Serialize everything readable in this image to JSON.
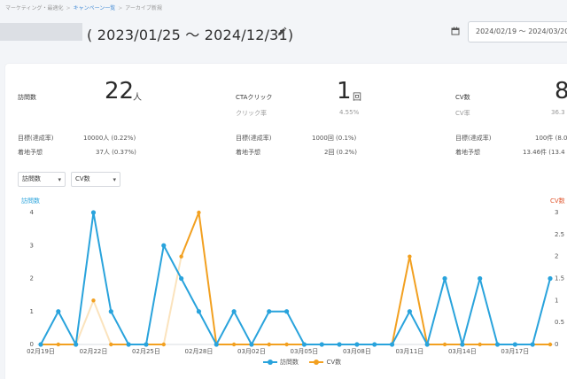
{
  "breadcrumb": [
    {
      "label": "マーケティング・最適化",
      "link": false
    },
    {
      "label": "キャンペーン一覧",
      "link": true
    },
    {
      "label": "アーカイブ新規",
      "link": false
    }
  ],
  "header": {
    "date_range": "( 2023/01/25 ～ 2024/12/31)",
    "picker_value": "2024/02/19 ～ 2024/03/20"
  },
  "metrics": [
    {
      "label": "訪問数",
      "value": "22",
      "unit": "人",
      "sub_label": "",
      "sub_value": "",
      "rows": [
        {
          "label": "目標(達成率)",
          "value": "10000人 (0.22%)"
        },
        {
          "label": "着地予想",
          "value": "37人 (0.37%)"
        }
      ]
    },
    {
      "label": "CTAクリック",
      "value": "1",
      "unit": "回",
      "sub_label": "クリック率",
      "sub_value": "4.55%",
      "rows": [
        {
          "label": "目標(達成率)",
          "value": "1000回 (0.1%)"
        },
        {
          "label": "着地予想",
          "value": "2回 (0.2%)"
        }
      ]
    },
    {
      "label": "CV数",
      "value": "8",
      "unit": "",
      "sub_label": "CV率",
      "sub_value": "36.3",
      "rows": [
        {
          "label": "目標(達成率)",
          "value": "100件 (8.0"
        },
        {
          "label": "着地予想",
          "value": "13.46件 (13.4"
        }
      ]
    }
  ],
  "selects": [
    {
      "value": "訪問数"
    },
    {
      "value": "CV数"
    }
  ],
  "colors": {
    "visits": "#29a3dc",
    "cv": "#f2a020",
    "cv_faded": "#fbe3bd",
    "cv_axis": "#e0552c"
  },
  "chart_data": {
    "type": "line",
    "x": [
      "02月19日",
      "02月20日",
      "02月21日",
      "02月22日",
      "02月23日",
      "02月24日",
      "02月25日",
      "02月26日",
      "02月27日",
      "02月28日",
      "02月29日",
      "03月01日",
      "03月02日",
      "03月03日",
      "03月04日",
      "03月05日",
      "03月06日",
      "03月07日",
      "03月08日",
      "03月09日",
      "03月10日",
      "03月11日",
      "03月12日",
      "03月13日",
      "03月14日",
      "03月15日",
      "03月16日",
      "03月17日",
      "03月18日",
      "03月19日"
    ],
    "x_tick_labels": [
      "02月19日",
      "02月22日",
      "02月25日",
      "02月28日",
      "03月02日",
      "03月05日",
      "03月08日",
      "03月11日",
      "03月14日",
      "03月17日"
    ],
    "y_left": {
      "label": "訪問数",
      "ticks": [
        "0",
        "1",
        "2",
        "3",
        "4"
      ],
      "ylim": [
        0,
        4
      ]
    },
    "y_right": {
      "label": "CV数",
      "ticks": [
        "0",
        "0.5",
        "1",
        "1.5",
        "2",
        "2.5",
        "3"
      ],
      "ylim": [
        0,
        3
      ]
    },
    "series": [
      {
        "name": "訪問数",
        "axis": "left",
        "values": [
          0,
          1,
          0,
          4,
          1,
          0,
          0,
          3,
          2,
          1,
          0,
          1,
          0,
          1,
          1,
          0,
          0,
          0,
          0,
          0,
          0,
          1,
          0,
          2,
          0,
          2,
          0,
          0,
          0,
          2
        ]
      },
      {
        "name": "CV数",
        "axis": "right",
        "values": [
          0,
          0,
          0,
          1,
          0,
          0,
          0,
          0,
          2,
          3,
          0,
          0,
          0,
          0,
          0,
          0,
          0,
          0,
          0,
          0,
          0,
          2,
          0,
          0,
          0,
          0,
          0,
          0,
          0,
          0
        ],
        "faded_segments": [
          [
            2,
            3
          ],
          [
            3,
            4
          ],
          [
            7,
            8
          ]
        ]
      }
    ],
    "legend_position": "bottom"
  }
}
